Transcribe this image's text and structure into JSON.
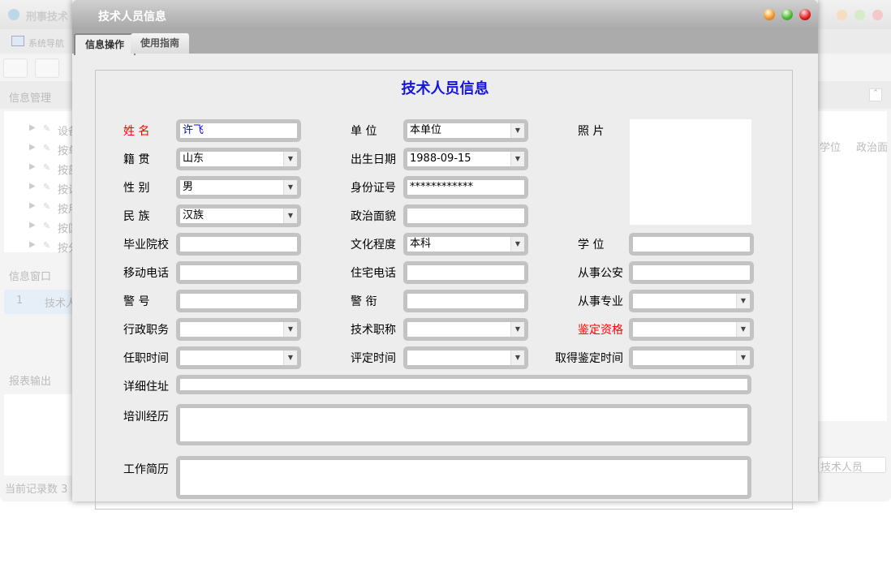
{
  "background_app": {
    "title": "刑事技术",
    "nav_tab": "系统导航",
    "panels": {
      "info_manage": "信息管理",
      "info_window": "信息窗口",
      "report_output": "报表输出"
    },
    "tree_items": [
      "设备",
      "按单",
      "按部",
      "按设",
      "按用",
      "按国",
      "按分"
    ],
    "window_row": {
      "index": "1",
      "text": "技术人"
    },
    "columns": [
      "学位",
      "政治面"
    ],
    "record_count": "当前记录数 3",
    "bottom_select": "技术人员"
  },
  "dialog": {
    "title": "技术人员信息",
    "tabs": [
      {
        "label": "信息操作",
        "active": true
      },
      {
        "label": "使用指南",
        "active": false
      }
    ],
    "form_title": "技术人员信息",
    "fields": {
      "name": {
        "label": "姓 名",
        "value": "许飞"
      },
      "unit": {
        "label": "单 位",
        "value": "本单位"
      },
      "photo": {
        "label": "照 片"
      },
      "native": {
        "label": "籍 贯",
        "value": "山东"
      },
      "birth": {
        "label": "出生日期",
        "value": "1988-09-15"
      },
      "gender": {
        "label": "性 别",
        "value": "男"
      },
      "idno": {
        "label": "身份证号",
        "value": "************"
      },
      "ethnic": {
        "label": "民 族",
        "value": "汉族"
      },
      "political": {
        "label": "政治面貌",
        "value": ""
      },
      "school": {
        "label": "毕业院校",
        "value": ""
      },
      "education": {
        "label": "文化程度",
        "value": "本科"
      },
      "degree": {
        "label": "学 位",
        "value": ""
      },
      "mobile": {
        "label": "移动电话",
        "value": ""
      },
      "homephone": {
        "label": "住宅电话",
        "value": ""
      },
      "police_work": {
        "label": "从事公安",
        "value": ""
      },
      "police_no": {
        "label": "警 号",
        "value": ""
      },
      "rank": {
        "label": "警 衔",
        "value": ""
      },
      "major": {
        "label": "从事专业",
        "value": ""
      },
      "admin_post": {
        "label": "行政职务",
        "value": ""
      },
      "tech_title": {
        "label": "技术职称",
        "value": ""
      },
      "qualification": {
        "label": "鉴定资格",
        "value": ""
      },
      "post_time": {
        "label": "任职时间",
        "value": ""
      },
      "eval_time": {
        "label": "评定时间",
        "value": ""
      },
      "qual_time": {
        "label": "取得鉴定时间",
        "value": ""
      },
      "address": {
        "label": "详细住址",
        "value": ""
      },
      "training": {
        "label": "培训经历",
        "value": ""
      },
      "resume": {
        "label": "工作简历",
        "value": ""
      }
    }
  },
  "colors": {
    "required_label": "#ff0000",
    "name_value": "#0000ff",
    "form_title": "#1515e0"
  }
}
